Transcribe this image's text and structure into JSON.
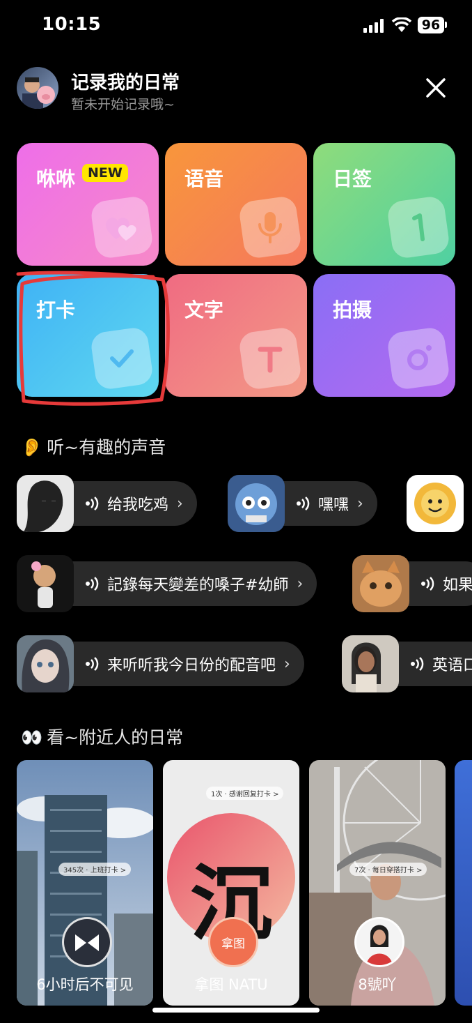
{
  "status_bar": {
    "time": "10:15",
    "battery": "96"
  },
  "header": {
    "title": "记录我的日常",
    "subtitle": "暂未开始记录哦~"
  },
  "tiles": [
    {
      "label": "咻咻",
      "badge": "NEW",
      "icon": "hearts-icon"
    },
    {
      "label": "语音",
      "icon": "microphone-icon"
    },
    {
      "label": "日签",
      "icon": "number-one-icon"
    },
    {
      "label": "打卡",
      "icon": "checkmark-icon"
    },
    {
      "label": "文字",
      "icon": "letter-t-icon"
    },
    {
      "label": "拍摄",
      "icon": "camera-icon"
    }
  ],
  "listen_section": {
    "emoji": "👂",
    "title": "听~有趣的声音"
  },
  "voice_chips": [
    {
      "text": "给我吃鸡"
    },
    {
      "text": "嘿嘿"
    },
    {
      "text": "記錄每天變差的嗓子#幼師"
    },
    {
      "text": "如果"
    },
    {
      "text": "来听听我今日份的配音吧"
    },
    {
      "text": "英语口"
    }
  ],
  "look_section": {
    "emoji": "👀",
    "title": "看~附近人的日常"
  },
  "stories": [
    {
      "label": "6小时后不可见",
      "pill": "345次 · 上班打卡 >"
    },
    {
      "label": "拿图 NATU",
      "pill": "1次 · 感谢回复打卡 >",
      "big_char": "沉",
      "badge": "拿图"
    },
    {
      "label": "8號吖",
      "pill": "7次 · 每日穿搭打卡 >"
    }
  ]
}
